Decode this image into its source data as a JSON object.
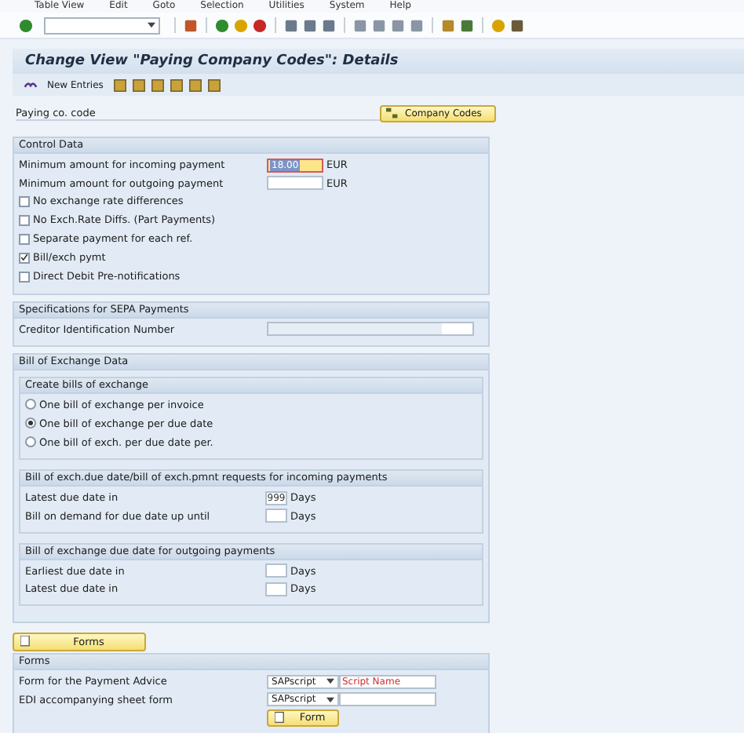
{
  "menu": [
    "Table View",
    "Edit",
    "Goto",
    "Selection",
    "Utilities",
    "System",
    "Help"
  ],
  "title": "Change View \"Paying Company Codes\": Details",
  "app_toolbar": {
    "new_entries": "New Entries"
  },
  "key_field": {
    "label": "Paying co. code",
    "button": "Company Codes"
  },
  "control_data": {
    "title": "Control Data",
    "fields": [
      {
        "label": "Minimum amount for incoming payment",
        "value": "18.00",
        "unit": "EUR",
        "focused": true
      },
      {
        "label": "Minimum amount for outgoing payment",
        "unit": "EUR",
        "focused": false
      }
    ],
    "checkboxes": [
      {
        "label": "No exchange rate differences",
        "checked": false
      },
      {
        "label": "No Exch.Rate Diffs. (Part Payments)",
        "checked": false
      },
      {
        "label": "Separate payment for each ref.",
        "checked": false
      },
      {
        "label": "Bill/exch pymt",
        "checked": true
      },
      {
        "label": "Direct Debit Pre-notifications",
        "checked": false
      }
    ]
  },
  "sepa": {
    "title": "Specifications for SEPA Payments",
    "fields": [
      {
        "label": "Creditor Identification Number",
        "disabled": true
      }
    ]
  },
  "bill_of_exchange": {
    "title": "Bill of Exchange Data",
    "create": {
      "title": "Create bills of exchange",
      "options": [
        {
          "label": "One bill of exchange per invoice",
          "selected": false
        },
        {
          "label": "One bill of exchange per due date",
          "selected": true
        },
        {
          "label": "One bill of exch. per due date per.",
          "selected": false
        }
      ]
    },
    "incoming": {
      "title": "Bill of exch.due date/bill of exch.pmnt requests for incoming payments",
      "fields": [
        {
          "label": "Latest due date in",
          "value": "999",
          "unit": "Days"
        },
        {
          "label": "Bill on demand for due date up until",
          "unit": "Days"
        }
      ]
    },
    "outgoing": {
      "title": "Bill of exchange due date for outgoing payments",
      "fields": [
        {
          "label": "Earliest due date in",
          "unit": "Days"
        },
        {
          "label": "Latest due date in",
          "unit": "Days"
        }
      ]
    }
  },
  "forms_button": "Forms",
  "forms": {
    "title": "Forms",
    "rows": [
      {
        "label": "Form for the Payment Advice",
        "type": "SAPscript",
        "placeholder": "Script Name"
      },
      {
        "label": "EDI accompanying sheet form",
        "type": "SAPscript"
      }
    ],
    "button": "Form"
  }
}
